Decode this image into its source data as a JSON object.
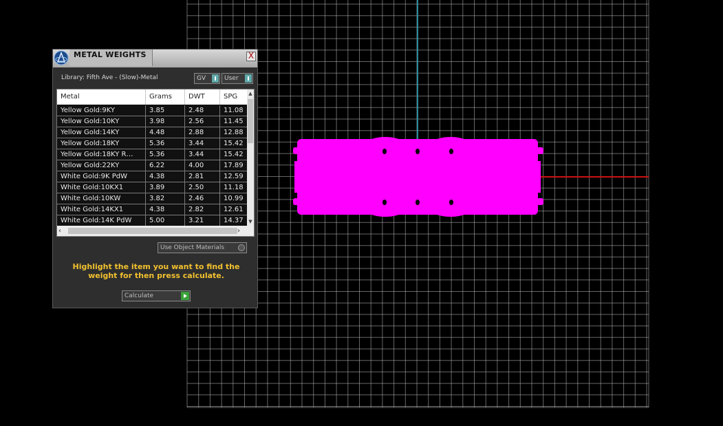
{
  "panel": {
    "title": "METAL WEIGHTS",
    "close_label": "X",
    "library_label": "Library: Fifth Ave - (Slow)-Metal",
    "toggles": {
      "gv": "GV",
      "user": "User"
    },
    "columns": [
      "Metal",
      "Grams",
      "DWT",
      "SPG"
    ],
    "rows": [
      [
        "Yellow Gold:9KY",
        "3.85",
        "2.48",
        "11.08"
      ],
      [
        "Yellow Gold:10KY",
        "3.98",
        "2.56",
        "11.45"
      ],
      [
        "Yellow Gold:14KY",
        "4.48",
        "2.88",
        "12.88"
      ],
      [
        "Yellow Gold:18KY",
        "5.36",
        "3.44",
        "15.42"
      ],
      [
        "Yellow Gold:18KY R…",
        "5.36",
        "3.44",
        "15.42"
      ],
      [
        "Yellow Gold:22KY",
        "6.22",
        "4.00",
        "17.89"
      ],
      [
        "White Gold:9K PdW",
        "4.38",
        "2.81",
        "12.59"
      ],
      [
        "White Gold:10KX1",
        "3.89",
        "2.50",
        "11.18"
      ],
      [
        "White Gold:10KW",
        "3.82",
        "2.46",
        "10.99"
      ],
      [
        "White Gold:14KX1",
        "4.38",
        "2.82",
        "12.61"
      ],
      [
        "White Gold:14K PdW",
        "5.00",
        "3.21",
        "14.37"
      ]
    ],
    "use_object_materials_label": "Use Object Materials",
    "instruction": "Highlight the item you want to find the weight for then press calculate.",
    "calculate_label": "Calculate"
  },
  "viewport": {
    "background_color": "#000000",
    "grid_color": "#bbbbbb",
    "y_axis_color": "#2a8a9a",
    "x_axis_color": "#cc1111",
    "object_color": "#ff00ff"
  },
  "colors": {
    "instruction": "#f2c12e",
    "toggle_knob": "#5fa8a8",
    "calculate_arrow": "#3aa33a"
  },
  "icons": {
    "app": "app-logo-icon",
    "close": "close-icon",
    "toggle": "toggle-icon",
    "check": "checkbox-icon",
    "go": "play-arrow-icon",
    "scroll_up": "chevron-up-icon",
    "scroll_down": "chevron-down-icon",
    "scroll_left": "chevron-left-icon",
    "scroll_right": "chevron-right-icon"
  }
}
